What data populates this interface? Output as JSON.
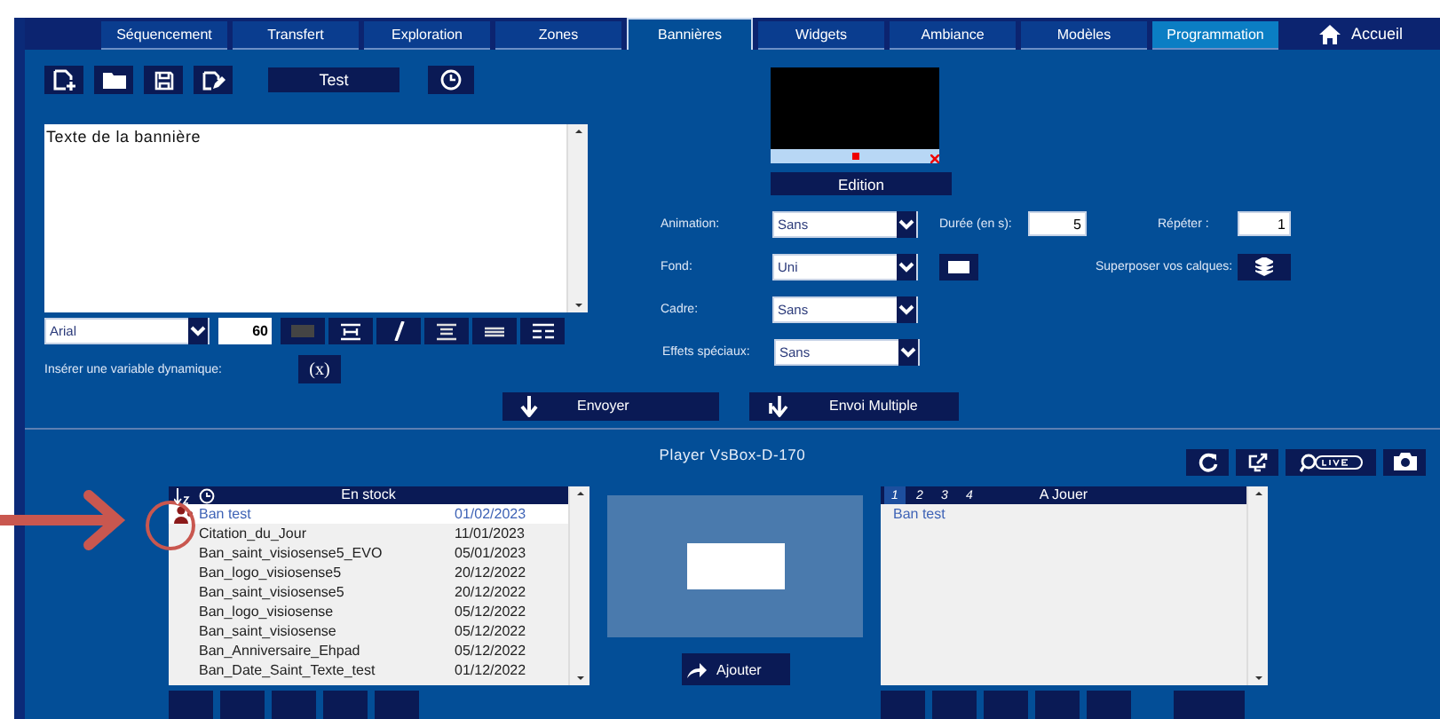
{
  "tabs": [
    {
      "label": "Séquencement",
      "selected": false,
      "highlighted": false
    },
    {
      "label": "Transfert",
      "selected": false,
      "highlighted": false
    },
    {
      "label": "Exploration",
      "selected": false,
      "highlighted": false
    },
    {
      "label": "Zones",
      "selected": false,
      "highlighted": false
    },
    {
      "label": "Bannières",
      "selected": true,
      "highlighted": false
    },
    {
      "label": "Widgets",
      "selected": false,
      "highlighted": false
    },
    {
      "label": "Ambiance",
      "selected": false,
      "highlighted": false
    },
    {
      "label": "Modèles",
      "selected": false,
      "highlighted": false
    },
    {
      "label": "Programmation",
      "selected": false,
      "highlighted": true
    }
  ],
  "home": {
    "label": "Accueil"
  },
  "toolbar": {
    "banner_name": "Test"
  },
  "editor": {
    "text": "Texte de la bannière",
    "font": "Arial",
    "size": "60",
    "variable_label": "Insérer une variable dynamique:",
    "variable_button": "(x)"
  },
  "preview": {
    "edit_button": "Edition"
  },
  "settings": {
    "animation": {
      "label": "Animation:",
      "value": "Sans"
    },
    "duration": {
      "label": "Durée (en s):",
      "value": "5"
    },
    "repeat": {
      "label": "Répéter :",
      "value": "1"
    },
    "background": {
      "label": "Fond:",
      "value": "Uni"
    },
    "frame": {
      "label": "Cadre:",
      "value": "Sans"
    },
    "effects": {
      "label": "Effets spéciaux:",
      "value": "Sans"
    },
    "layers_label": "Superposer vos calques:"
  },
  "send_buttons": [
    "Envoyer",
    "Envoi Multiple"
  ],
  "player": {
    "title": "Player VsBox-D-170"
  },
  "stock": {
    "header": "En stock",
    "rows": [
      {
        "name": "Ban test",
        "date": "01/02/2023",
        "selected": true,
        "flagged": true
      },
      {
        "name": "Citation_du_Jour",
        "date": "11/01/2023",
        "selected": false,
        "flagged": false
      },
      {
        "name": "Ban_saint_visiosense5_EVO",
        "date": "05/01/2023",
        "selected": false,
        "flagged": false
      },
      {
        "name": "Ban_logo_visiosense5",
        "date": "20/12/2022",
        "selected": false,
        "flagged": false
      },
      {
        "name": "Ban_saint_visiosense5",
        "date": "20/12/2022",
        "selected": false,
        "flagged": false
      },
      {
        "name": "Ban_logo_visiosense",
        "date": "05/12/2022",
        "selected": false,
        "flagged": false
      },
      {
        "name": "Ban_saint_visiosense",
        "date": "05/12/2022",
        "selected": false,
        "flagged": false
      },
      {
        "name": "Ban_Anniversaire_Ehpad",
        "date": "05/12/2022",
        "selected": false,
        "flagged": false
      },
      {
        "name": "Ban_Date_Saint_Texte_test",
        "date": "01/12/2022",
        "selected": false,
        "flagged": false
      }
    ]
  },
  "add_button": "Ajouter",
  "queue": {
    "header": "A Jouer",
    "pages": [
      {
        "label": "1",
        "selected": true
      },
      {
        "label": "2",
        "selected": false
      },
      {
        "label": "3",
        "selected": false
      },
      {
        "label": "4",
        "selected": false
      }
    ],
    "rows": [
      "Ban test"
    ]
  }
}
